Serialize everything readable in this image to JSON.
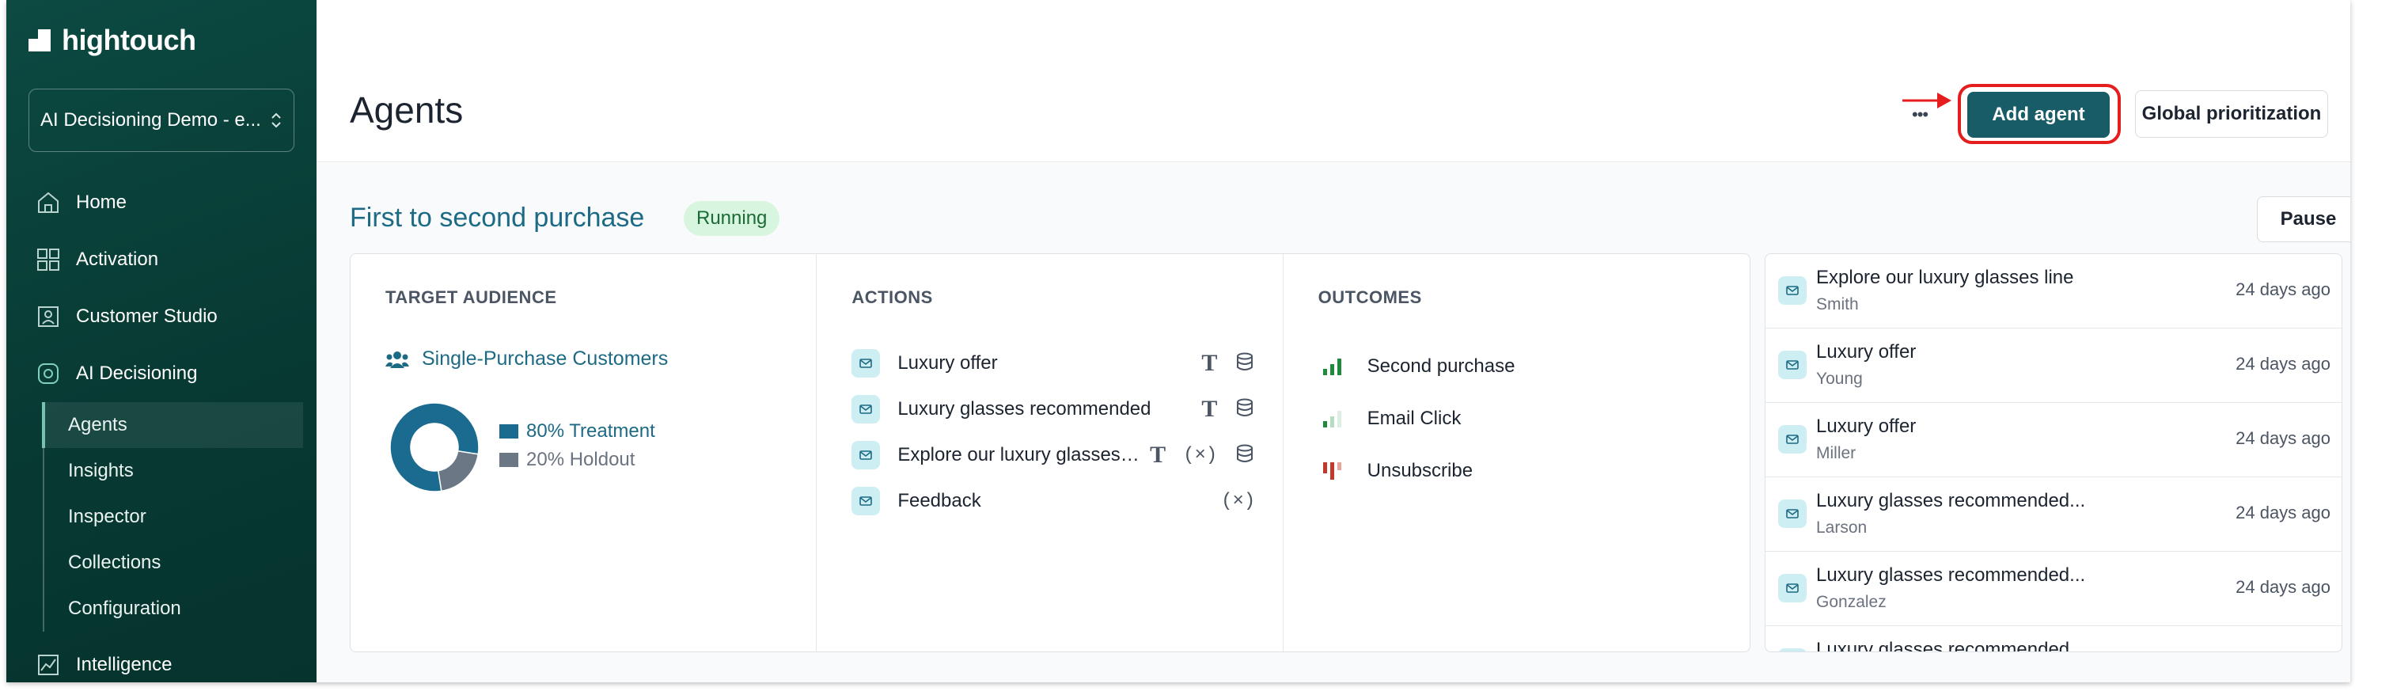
{
  "brand": {
    "name": "hightouch"
  },
  "workspace": {
    "label": "AI Decisioning Demo - e...",
    "chevron": "⌃⌄"
  },
  "nav": {
    "items": [
      {
        "label": "Home",
        "icon": "home-icon"
      },
      {
        "label": "Activation",
        "icon": "activation-icon"
      },
      {
        "label": "Customer Studio",
        "icon": "customer-studio-icon"
      },
      {
        "label": "AI Decisioning",
        "icon": "ai-decisioning-icon"
      }
    ],
    "sub_items": [
      "Agents",
      "Insights",
      "Inspector",
      "Collections",
      "Configuration"
    ],
    "active_sub": "Agents",
    "bottom_item": {
      "label": "Intelligence",
      "icon": "intelligence-icon"
    }
  },
  "header": {
    "title": "Agents",
    "more_label": "•••",
    "add_agent_label": "Add agent",
    "global_label": "Global prioritization"
  },
  "agent": {
    "name": "First to second purchase",
    "status": "Running",
    "pause_label": "Pause"
  },
  "audience": {
    "heading": "TARGET AUDIENCE",
    "name": "Single-Purchase Customers",
    "split": [
      {
        "label": "80% Treatment",
        "percent": 80,
        "color": "#1b6a8f",
        "text_color": "#1d6a85"
      },
      {
        "label": "20% Holdout",
        "percent": 20,
        "color": "#6b7785",
        "text_color": "#6b7280"
      }
    ]
  },
  "actions": {
    "heading": "ACTIONS",
    "items": [
      {
        "label": "Luxury offer",
        "icons": [
          "text-icon",
          "database-icon"
        ]
      },
      {
        "label": "Luxury glasses recommended",
        "icons": [
          "text-icon",
          "database-icon"
        ]
      },
      {
        "label": "Explore our luxury glasses line",
        "icons": [
          "text-icon",
          "variable-icon",
          "database-icon"
        ]
      },
      {
        "label": "Feedback",
        "icons": [
          "variable-icon"
        ]
      }
    ],
    "variable_glyph": "(×)",
    "text_glyph": "T"
  },
  "outcomes": {
    "heading": "OUTCOMES",
    "items": [
      {
        "label": "Second purchase",
        "icon": "signal-strong-icon",
        "color": "#1f8a3a"
      },
      {
        "label": "Email Click",
        "icon": "signal-weak-icon",
        "color": "#1f8a3a"
      },
      {
        "label": "Unsubscribe",
        "icon": "signal-negative-icon",
        "color": "#c0392b"
      }
    ]
  },
  "feed": {
    "items": [
      {
        "title": "Explore our luxury glasses line",
        "user": "Smith",
        "time": "24 days ago"
      },
      {
        "title": "Luxury offer",
        "user": "Young",
        "time": "24 days ago"
      },
      {
        "title": "Luxury offer",
        "user": "Miller",
        "time": "24 days ago"
      },
      {
        "title": "Luxury glasses recommended...",
        "user": "Larson",
        "time": "24 days ago"
      },
      {
        "title": "Luxury glasses recommended...",
        "user": "Gonzalez",
        "time": "24 days ago"
      },
      {
        "title": "Luxury glasses recommended...",
        "user": "",
        "time": ""
      }
    ]
  },
  "colors": {
    "sidebar": "#073a33",
    "accent": "#175c66",
    "link": "#1d6a85",
    "annotation": "#e51d1d"
  }
}
